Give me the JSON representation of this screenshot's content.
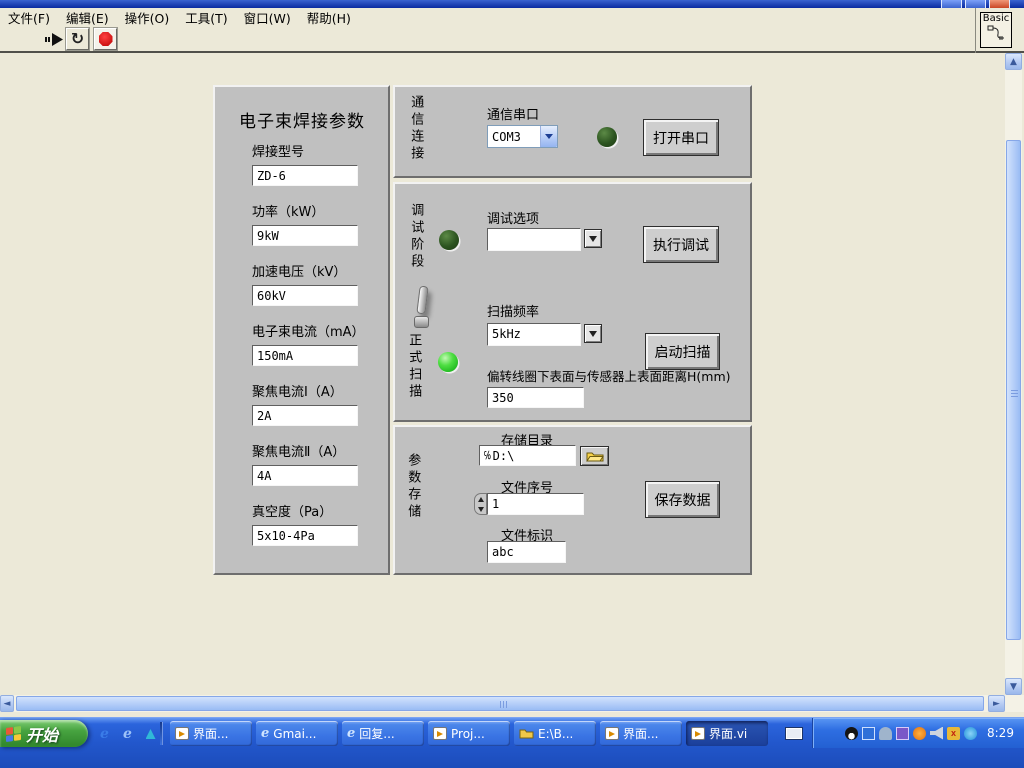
{
  "menu_bar": {
    "items": [
      {
        "label": "文件(F)"
      },
      {
        "label": "编辑(E)"
      },
      {
        "label": "操作(O)"
      },
      {
        "label": "工具(T)"
      },
      {
        "label": "窗口(W)"
      },
      {
        "label": "帮助(H)"
      }
    ]
  },
  "toolbar": {
    "loop_glyph": "↻"
  },
  "connector_pane": {
    "label": "Basic"
  },
  "left_panel": {
    "title": "电子束焊接参数",
    "fields": [
      {
        "label": "焊接型号",
        "value": "ZD-6"
      },
      {
        "label": "功率（kW）",
        "value": "9kW"
      },
      {
        "label": "加速电压（kV）",
        "value": "60kV"
      },
      {
        "label": "电子束电流（mA）",
        "value": "150mA"
      },
      {
        "label": "聚焦电流Ⅰ（A）",
        "value": "2A"
      },
      {
        "label": "聚焦电流Ⅱ（A）",
        "value": "4A"
      },
      {
        "label": "真空度（Pa）",
        "value": "5x10-4Pa"
      }
    ]
  },
  "comm_section": {
    "side_label": "通信连接",
    "port_label": "通信串口",
    "port_value": "COM3",
    "open_button": "打开串口",
    "led_state": "off"
  },
  "debug_section": {
    "side_label": "调试阶段",
    "option_label": "调试选项",
    "option_value": "",
    "execute_button": "执行调试",
    "led_state": "off"
  },
  "scan_section": {
    "side_label": "正式扫描",
    "freq_label": "扫描频率",
    "freq_value": "5kHz",
    "distance_label": "偏转线圈下表面与传感器上表面距离H(mm)",
    "distance_value": "350",
    "start_button": "启动扫描",
    "led_state": "on"
  },
  "storage_section": {
    "side_label": "参数存储",
    "dir_label": "存储目录",
    "dir_glyph": "℅",
    "dir_value": "D:\\",
    "file_no_label": "文件序号",
    "file_no_value": "1",
    "file_id_label": "文件标识",
    "file_id_value": "abc",
    "save_button": "保存数据"
  },
  "taskbar": {
    "start_label": "开始",
    "tasks": [
      {
        "label": "界面...",
        "icon": "labview"
      },
      {
        "label": "Gmai...",
        "icon": "ie"
      },
      {
        "label": "回复...",
        "icon": "ie"
      },
      {
        "label": "Proj...",
        "icon": "labview"
      },
      {
        "label": "E:\\B...",
        "icon": "folder"
      },
      {
        "label": "界面...",
        "icon": "labview"
      },
      {
        "label": "界面.vi",
        "icon": "labview",
        "active": true
      }
    ],
    "clock": "8:29"
  },
  "colors": {
    "panel_gray": "#c0c0c0",
    "desktop_beige": "#ece9d8",
    "led_on": "#3ede3e",
    "led_off": "#2c5420",
    "taskbar_blue": "#2257cc",
    "start_green": "#47a340"
  }
}
